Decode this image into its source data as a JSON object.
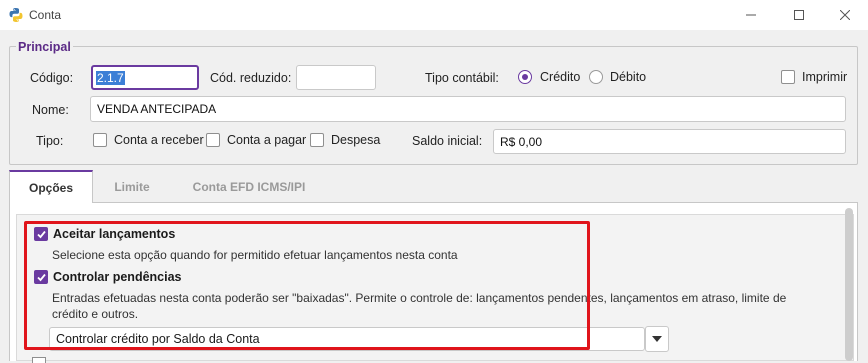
{
  "window": {
    "title": "Conta",
    "app_icon": "python-icon",
    "controls": {
      "minimize_icon": "minimize-icon",
      "maximize_icon": "maximize-icon",
      "close_icon": "close-icon"
    }
  },
  "principal": {
    "legend": "Principal",
    "codigo_label": "Código:",
    "codigo_value": "2.1.7",
    "cod_reduzido_label": "Cód. reduzido:",
    "cod_reduzido_value": "",
    "tipo_contabil_label": "Tipo contábil:",
    "tipo_contabil_options": [
      {
        "label": "Crédito",
        "selected": true
      },
      {
        "label": "Débito",
        "selected": false
      }
    ],
    "imprimir_label": "Imprimir",
    "imprimir_checked": false,
    "nome_label": "Nome:",
    "nome_value": "VENDA ANTECIPADA",
    "tipo_label": "Tipo:",
    "tipo_options": [
      {
        "label": "Conta a receber",
        "checked": false
      },
      {
        "label": "Conta a pagar",
        "checked": false
      },
      {
        "label": "Despesa",
        "checked": false
      }
    ],
    "saldo_inicial_label": "Saldo inicial:",
    "saldo_inicial_value": "R$ 0,00"
  },
  "tabs": [
    {
      "label": "Opções",
      "active": true
    },
    {
      "label": "Limite",
      "active": false
    },
    {
      "label": "Conta EFD ICMS/IPI",
      "active": false
    }
  ],
  "opcoes": {
    "aceitar": {
      "label": "Aceitar lançamentos",
      "checked": true,
      "description": "Selecione esta opção quando for permitido efetuar lançamentos nesta conta"
    },
    "controlar": {
      "label": "Controlar pendências",
      "checked": true,
      "description_line1": "Entradas efetuadas nesta conta poderão ser \"baixadas\". Permite o controle de: lançamentos pendentes, lançamentos em atraso, limite de",
      "description_line2": "crédito e outros."
    },
    "controle_select": {
      "value": "Controlar crédito por Saldo da Conta",
      "icon": "chevron-down-icon"
    }
  },
  "colors": {
    "accent": "#6a3aa0",
    "highlight": "#e0141b",
    "selection": "#3c7fd6"
  }
}
